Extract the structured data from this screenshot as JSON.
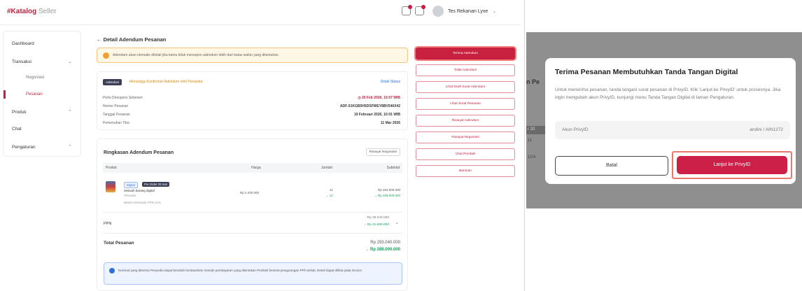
{
  "header": {
    "logo_brand": "#Katalog",
    "logo_suffix": "Seller",
    "user_name": "Tes Rekanan Lyxe"
  },
  "sidebar": {
    "items": [
      {
        "label": "Dashboard"
      },
      {
        "label": "Transaksi"
      },
      {
        "label": "Negosiasi"
      },
      {
        "label": "Pesanan"
      },
      {
        "label": "Produk"
      },
      {
        "label": "Chat"
      },
      {
        "label": "Pengaturan"
      }
    ]
  },
  "page": {
    "back_title": "Detail Adendum Pesanan",
    "alert_text": "Adendum akan otomatis ditolak jika kamu tidak merespon adendum lebih dari batas waktu yang ditentukan."
  },
  "summary": {
    "badge": "Adendum",
    "status": "Menunggu Konfirmasi Adendum oleh Penyedia",
    "detail_link": "Detail Status",
    "rows": [
      {
        "label": "Perlu Direspons Sebelum",
        "value": "20 Feb 2026, 10:07 WIB"
      },
      {
        "label": "Nomor Pesanan",
        "value": "ADF-01KGB5H5DSFWEY8BV546X42"
      },
      {
        "label": "Tanggal Pesanan",
        "value": "19 Februari 2026, 10:01 WIB"
      },
      {
        "label": "Pemenuhan Tiba",
        "value": "11 Mar 2026"
      }
    ]
  },
  "order": {
    "title": "Ringkasan Adendum Pesanan",
    "history_button": "Riwayat Negosiasi",
    "columns": [
      "Produk",
      "Harga",
      "Jumlah",
      "Subtotal"
    ],
    "product": {
      "tag1": "Digital",
      "tag2": "Pre Order 30 Hari",
      "name": "Sebuah barang digital",
      "variant": "Tersedia",
      "tax_note": "Belum termasuk PPN 11%",
      "price": "Rp 2.400.000",
      "qty_old": "11",
      "qty_new": "→ 12",
      "subtotal_old": "Rp 264.000.000",
      "subtotal_new": "→ Rp 288.000.000"
    },
    "ppn_label": "PPN",
    "ppn_old": "Rp 29.040.000",
    "ppn_new": "→ Rp 31.680.000",
    "total_label": "Total Pesanan",
    "total_old": "Rp 293.040.000",
    "total_new": "→ Rp 288.000.000",
    "info_text": "Nominal yang diterima Penyedia dapat berubah berdasarkan metode pembayaran yang ditentukan Pembeli beserta pengurangan PPh terkait. Detail dapat dilihat pada invoice."
  },
  "actions": [
    {
      "label": "Terima Adendum",
      "primary": true
    },
    {
      "label": "Tolak Adendum"
    },
    {
      "label": "Lihat Draft Surat Adendum"
    },
    {
      "label": "Lihat Surat Pesanan"
    },
    {
      "label": "Riwayat Adendum"
    },
    {
      "label": "Riwayat Negosiasi"
    },
    {
      "label": "Chat Pembeli"
    },
    {
      "label": "Bantuan"
    }
  ],
  "modal": {
    "title": "Terima Pesanan Membutuhkan Tanda Tangan Digital",
    "body": "Untuk menerima pesanan, tanda tangani surat pesanan di PrivyID. Klik 'Lanjut ke PrivyID' untuk prosesnya. Jika ingin mengubah akun PrivyID, kunjungi menu Tanda Tangan Digital di laman Pengaturan.",
    "field_label": "Akun PrivyID",
    "field_value": "andini / AIN1272",
    "cancel_label": "Batal",
    "confirm_label": "Lanjut ke PrivyID"
  },
  "background": {
    "frag1": "n Pe",
    "frag2": "r 20",
    "frag3": "11",
    "frag4": "11%"
  },
  "colors": {
    "brand": "#c0213f",
    "success": "#1a9e5a",
    "link": "#2f6fd8",
    "warning": "#f0a030"
  }
}
